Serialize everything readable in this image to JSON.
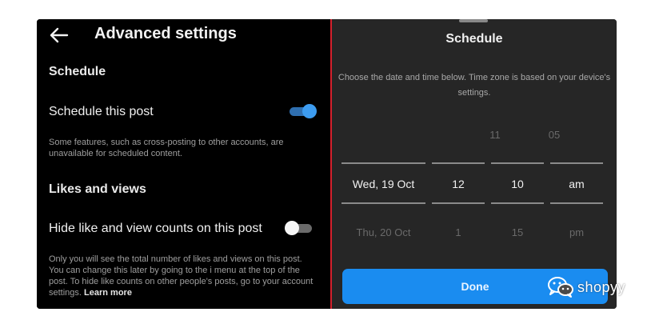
{
  "left": {
    "header_title": "Advanced settings",
    "schedule_section": "Schedule",
    "schedule_toggle_label": "Schedule this post",
    "schedule_toggle_on": true,
    "schedule_note": "Some features, such as cross-posting to other accounts, are unavailable for scheduled content.",
    "likes_section": "Likes and views",
    "hide_counts_label": "Hide like and view counts on this post",
    "hide_counts_on": false,
    "likes_note": "Only you will see the total number of likes and views on this post. You can change this later by going to the i menu at the top of the post. To hide like counts on other people's posts, go to your account settings.",
    "learn_more": "Learn more"
  },
  "right": {
    "title": "Schedule",
    "description": "Choose the date and time below. Time zone is based on your device's settings.",
    "picker": {
      "prev": {
        "date": "",
        "hour": "11",
        "minute": "05",
        "ampm": ""
      },
      "selected": {
        "date": "Wed, 19 Oct",
        "hour": "12",
        "minute": "10",
        "ampm": "am"
      },
      "next": {
        "date": "Thu, 20 Oct",
        "hour": "1",
        "minute": "15",
        "ampm": "pm"
      }
    },
    "done_label": "Done"
  },
  "watermark": {
    "text": "shopyy"
  },
  "colors": {
    "accent": "#1a8cf0",
    "toggle_on": "#3d9cf0",
    "divider": "#d4202c",
    "sheet_bg": "#262626"
  }
}
